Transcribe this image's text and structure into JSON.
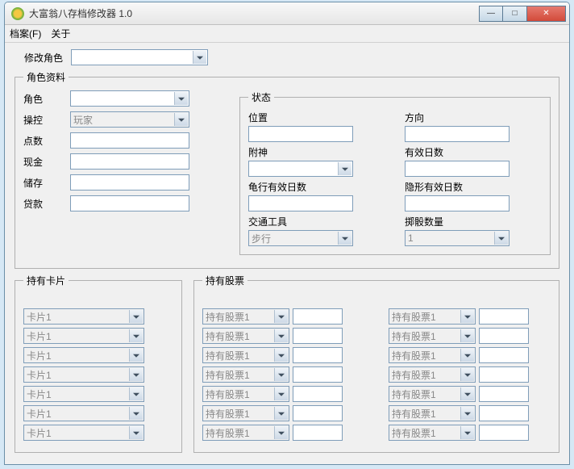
{
  "window": {
    "title": "大富翁八存档修改器 1.0",
    "buttons": {
      "min": "—",
      "max": "□",
      "close": "✕"
    }
  },
  "menu": {
    "file": "档案(F)",
    "about": "关于"
  },
  "modifyChar": {
    "label": "修改角色",
    "value": ""
  },
  "charInfo": {
    "legend": "角色资料",
    "role": {
      "label": "角色",
      "value": ""
    },
    "control": {
      "label": "操控",
      "value": "玩家"
    },
    "points": {
      "label": "点数",
      "value": ""
    },
    "cash": {
      "label": "现金",
      "value": ""
    },
    "savings": {
      "label": "储存",
      "value": ""
    },
    "loan": {
      "label": "贷款",
      "value": ""
    }
  },
  "status": {
    "legend": "状态",
    "position": {
      "label": "位置",
      "value": ""
    },
    "direction": {
      "label": "方向",
      "value": ""
    },
    "attached": {
      "label": "附神",
      "value": ""
    },
    "validDays": {
      "label": "有效日数",
      "value": ""
    },
    "turtleDays": {
      "label": "龟行有效日数",
      "value": ""
    },
    "invisibleDays": {
      "label": "隐形有效日数",
      "value": ""
    },
    "transport": {
      "label": "交通工具",
      "value": "步行"
    },
    "diceCount": {
      "label": "掷骰数量",
      "value": "1"
    }
  },
  "cards": {
    "legend": "持有卡片",
    "items": [
      "卡片1",
      "卡片1",
      "卡片1",
      "卡片1",
      "卡片1",
      "卡片1",
      "卡片1"
    ]
  },
  "stocks": {
    "legend": "持有股票",
    "colA": [
      {
        "name": "持有股票1",
        "qty": ""
      },
      {
        "name": "持有股票1",
        "qty": ""
      },
      {
        "name": "持有股票1",
        "qty": ""
      },
      {
        "name": "持有股票1",
        "qty": ""
      },
      {
        "name": "持有股票1",
        "qty": ""
      },
      {
        "name": "持有股票1",
        "qty": ""
      },
      {
        "name": "持有股票1",
        "qty": ""
      }
    ],
    "colB": [
      {
        "name": "持有股票1",
        "qty": ""
      },
      {
        "name": "持有股票1",
        "qty": ""
      },
      {
        "name": "持有股票1",
        "qty": ""
      },
      {
        "name": "持有股票1",
        "qty": ""
      },
      {
        "name": "持有股票1",
        "qty": ""
      },
      {
        "name": "持有股票1",
        "qty": ""
      },
      {
        "name": "持有股票1",
        "qty": ""
      }
    ]
  }
}
